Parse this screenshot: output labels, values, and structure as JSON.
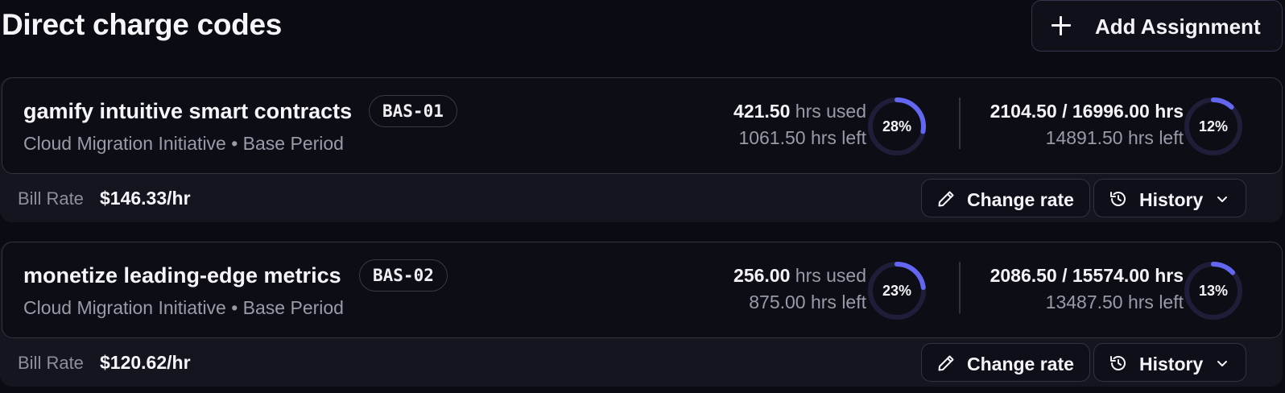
{
  "page": {
    "title": "Direct charge codes",
    "add_button_label": "Add Assignment"
  },
  "colors": {
    "background": "#0b0b14",
    "card": "#0d0d16",
    "ring_track": "#1e1e38",
    "ring_fill": "#6366f1",
    "muted_text": "#9a9aa8"
  },
  "assignments": [
    {
      "name": "gamify intuitive smart contracts",
      "code": "BAS-01",
      "subtitle": "Cloud Migration Initiative • Base Period",
      "hours_used_num": "421.50",
      "hours_used_label": "hrs used",
      "hours_left": "1061.50 hrs left",
      "used_pct": 28,
      "used_pct_label": "28%",
      "total_ratio": "2104.50 / 16996.00 hrs",
      "total_left": "14891.50 hrs left",
      "total_pct": 12,
      "total_pct_label": "12%",
      "bill_rate_label": "Bill Rate",
      "bill_rate": "$146.33/hr",
      "change_rate_label": "Change rate",
      "history_label": "History"
    },
    {
      "name": "monetize leading-edge metrics",
      "code": "BAS-02",
      "subtitle": "Cloud Migration Initiative • Base Period",
      "hours_used_num": "256.00",
      "hours_used_label": "hrs used",
      "hours_left": "875.00 hrs left",
      "used_pct": 23,
      "used_pct_label": "23%",
      "total_ratio": "2086.50 / 15574.00 hrs",
      "total_left": "13487.50 hrs left",
      "total_pct": 13,
      "total_pct_label": "13%",
      "bill_rate_label": "Bill Rate",
      "bill_rate": "$120.62/hr",
      "change_rate_label": "Change rate",
      "history_label": "History"
    }
  ],
  "icons": {
    "add": "plus-icon",
    "change_rate": "pencil-icon",
    "history": "history-icon",
    "history_toggle": "chevron-down-icon"
  }
}
